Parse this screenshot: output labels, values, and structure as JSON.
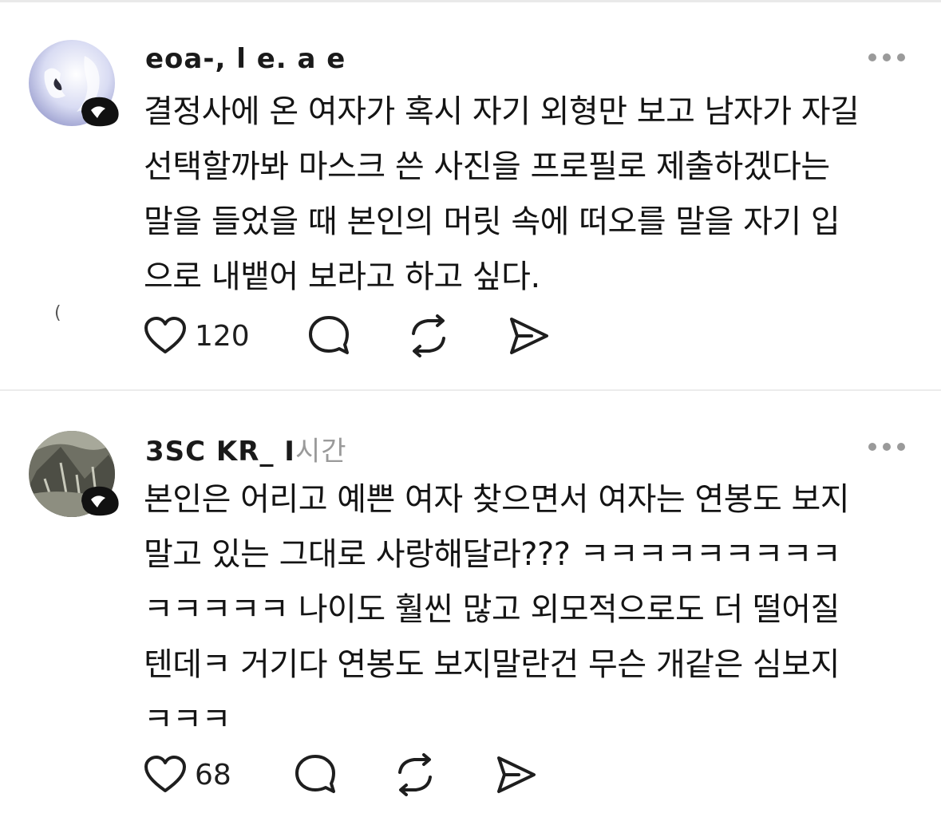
{
  "posts": [
    {
      "username": "eoa-, l e. a e",
      "username_faded": "",
      "lines": [
        "결정사에 온 여자가 혹시 자기 외형만 보고 남자가 자길",
        "선택할까봐 마스크 쓴 사진을 프로필로 제출하겠다는",
        "말을 들었을 때 본인의 머릿 속에 떠오를 말을 자기 입",
        "으로 내뱉어 보라고 하고 싶다."
      ],
      "likes": "120",
      "thread_mark": "(",
      "icons": {
        "like": "heart-icon",
        "reply": "speech-bubble-icon",
        "repost": "repost-icon",
        "share": "send-icon",
        "more": "more-dots-icon"
      }
    },
    {
      "username": "3SC KR_ I",
      "username_faded": "시간",
      "lines": [
        "본인은 어리고 예쁜 여자 찾으면서 여자는 연봉도 보지",
        "말고 있는 그대로 사랑해달라??? ㅋㅋㅋㅋㅋㅋㅋㅋㅋ",
        "ㅋㅋㅋㅋㅋ 나이도 훨씬 많고 외모적으로도 더 떨어질",
        "텐데ㅋ 거기다 연봉도 보지말란건 무슨 개같은 심보지",
        "ㅋㅋㅋ"
      ],
      "likes": "68",
      "icons": {
        "like": "heart-icon",
        "reply": "speech-bubble-icon",
        "repost": "repost-icon",
        "share": "send-icon",
        "more": "more-dots-icon"
      }
    }
  ],
  "colors": {
    "text": "#141414",
    "secondary": "#9a9a9a",
    "divider": "#ececec"
  }
}
